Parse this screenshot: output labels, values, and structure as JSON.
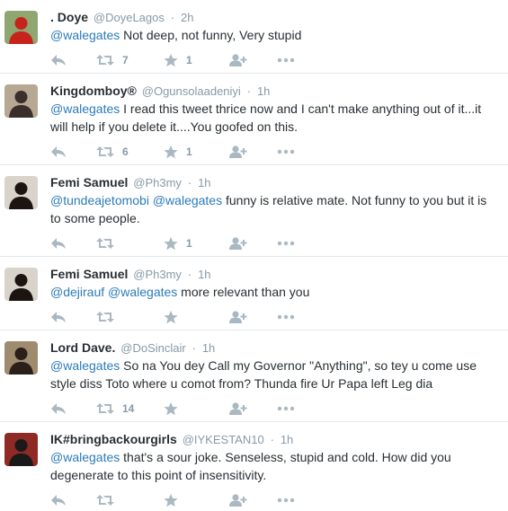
{
  "tweets": [
    {
      "name": ". Doye",
      "handle": "@DoyeLagos",
      "sep": "·",
      "time": "2h",
      "segments": [
        {
          "text": "@walegates",
          "type": "mention"
        },
        {
          "text": " Not deep, not funny, Very stupid",
          "type": "text"
        }
      ],
      "retweets": "7",
      "favorites": "1",
      "avatar": {
        "bg": "#8ea66f",
        "fg": "#c7231d"
      }
    },
    {
      "name": "Kingdomboy®",
      "handle": "@Ogunsolaadeniyi",
      "sep": "·",
      "time": "1h",
      "segments": [
        {
          "text": "@walegates",
          "type": "mention"
        },
        {
          "text": " I read this tweet thrice now and I can't make anything out of it...it will help if you delete it....You goofed on this.",
          "type": "text"
        }
      ],
      "retweets": "6",
      "favorites": "1",
      "avatar": {
        "bg": "#b6a892",
        "fg": "#3a2f2a"
      }
    },
    {
      "name": "Femi Samuel",
      "handle": "@Ph3my",
      "sep": "·",
      "time": "1h",
      "segments": [
        {
          "text": "@tundeajetomobi",
          "type": "mention"
        },
        {
          "text": " ",
          "type": "text"
        },
        {
          "text": "@walegates",
          "type": "mention"
        },
        {
          "text": " funny is relative mate. Not funny to you but it is to some people.",
          "type": "text"
        }
      ],
      "retweets": "",
      "favorites": "1",
      "avatar": {
        "bg": "#d8d3cb",
        "fg": "#1b1410"
      }
    },
    {
      "name": "Femi Samuel",
      "handle": "@Ph3my",
      "sep": "·",
      "time": "1h",
      "segments": [
        {
          "text": "@dejirauf",
          "type": "mention"
        },
        {
          "text": " ",
          "type": "text"
        },
        {
          "text": "@walegates",
          "type": "mention"
        },
        {
          "text": " more relevant than you",
          "type": "text"
        }
      ],
      "retweets": "",
      "favorites": "",
      "avatar": {
        "bg": "#d8d3cb",
        "fg": "#1b1410"
      }
    },
    {
      "name": "Lord Dave.",
      "handle": "@DoSinclair",
      "sep": "·",
      "time": "1h",
      "segments": [
        {
          "text": "@walegates",
          "type": "mention"
        },
        {
          "text": " So na You dey Call my Governor \"Anything\", so tey u come use style diss Toto where u comot from? Thunda fire Ur Papa left Leg dia",
          "type": "text"
        }
      ],
      "retweets": "14",
      "favorites": "",
      "avatar": {
        "bg": "#9f8c6f",
        "fg": "#2a1f19"
      }
    },
    {
      "name": "IK#bringbackourgirls",
      "handle": "@IYKESTAN10",
      "sep": "·",
      "time": "1h",
      "segments": [
        {
          "text": "@walegates",
          "type": "mention"
        },
        {
          "text": " that's a sour joke. Senseless, stupid and cold. How did you degenerate to this point of insensitivity.",
          "type": "text"
        }
      ],
      "retweets": "",
      "favorites": "",
      "avatar": {
        "bg": "#8f2a24",
        "fg": "#1a1a1a"
      }
    }
  ],
  "icons": {
    "reply": "reply-icon",
    "retweet": "retweet-icon",
    "favorite": "star-icon",
    "follow": "follow-icon",
    "more": "more-icon"
  },
  "colors": {
    "mention": "#2b7bb9",
    "muted": "#8899a6",
    "icon": "#aab8c2",
    "divider": "#e1e8ed"
  }
}
